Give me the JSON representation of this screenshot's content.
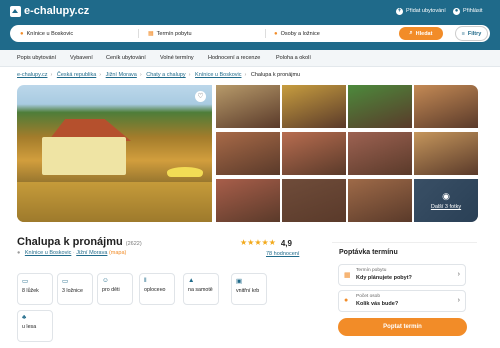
{
  "header": {
    "logo_text": "e-chalupy.cz",
    "add_listing": "Přidat ubytování",
    "login": "Přihlásit"
  },
  "search": {
    "location": "Knínice u Boskovic",
    "dates": "Termín pobytu",
    "guests": "Osoby a ložnice",
    "search_label": "Hledat",
    "filters_label": "Filtry"
  },
  "nav": {
    "items": [
      "Popis ubytování",
      "Vybavení",
      "Ceník ubytování",
      "Volné termíny",
      "Hodnocení a recenze",
      "Poloha a okolí"
    ]
  },
  "breadcrumbs": [
    "e-chalupy.cz",
    "Česká republika",
    "Jižní Morava",
    "Chaty a chalupy",
    "Knínice u Boskovic",
    "Chalupa k pronájmu"
  ],
  "gallery": {
    "thumb_colors": [
      "#b79a6a",
      "#c79d3f",
      "#4c8a3c",
      "#c48a55",
      "#a86a48",
      "#b86d50",
      "#9d6252",
      "#c5965c",
      "#a85e4a",
      "#6f4c3a",
      "#9e6a48"
    ],
    "more_photos": "Další 3 fotky"
  },
  "listing": {
    "title": "Chalupa k pronájmu",
    "id_label": "(2622)",
    "location_village": "Knínice u Boskovic",
    "location_region": "Jižní Morava",
    "map_label": "(mapa)",
    "rating": "4,9",
    "reviews": "78 hodnocení"
  },
  "features": [
    {
      "icon": "bed-icon",
      "label": "8 lůžek"
    },
    {
      "icon": "bedroom-icon",
      "label": "3 ložnice"
    },
    {
      "icon": "kids-icon",
      "label": "pro děti"
    },
    {
      "icon": "fence-icon",
      "label": "oplocено"
    },
    {
      "icon": "mountain-icon",
      "label": "na samotě"
    },
    {
      "icon": "fireplace-icon",
      "label": "vnitřní krb"
    },
    {
      "icon": "forest-icon",
      "label": "u lesa"
    }
  ],
  "inquiry": {
    "title": "Poptávka termínu",
    "stay_label": "Termín pobytu",
    "stay_value": "Kdy plánujete pobyt?",
    "guests_label": "Počet osob",
    "guests_value": "Kolik vás bude?",
    "submit": "Poptat termín"
  },
  "colors": {
    "brand": "#1f6a8a",
    "accent": "#f28c28",
    "star": "#f2a91b"
  }
}
